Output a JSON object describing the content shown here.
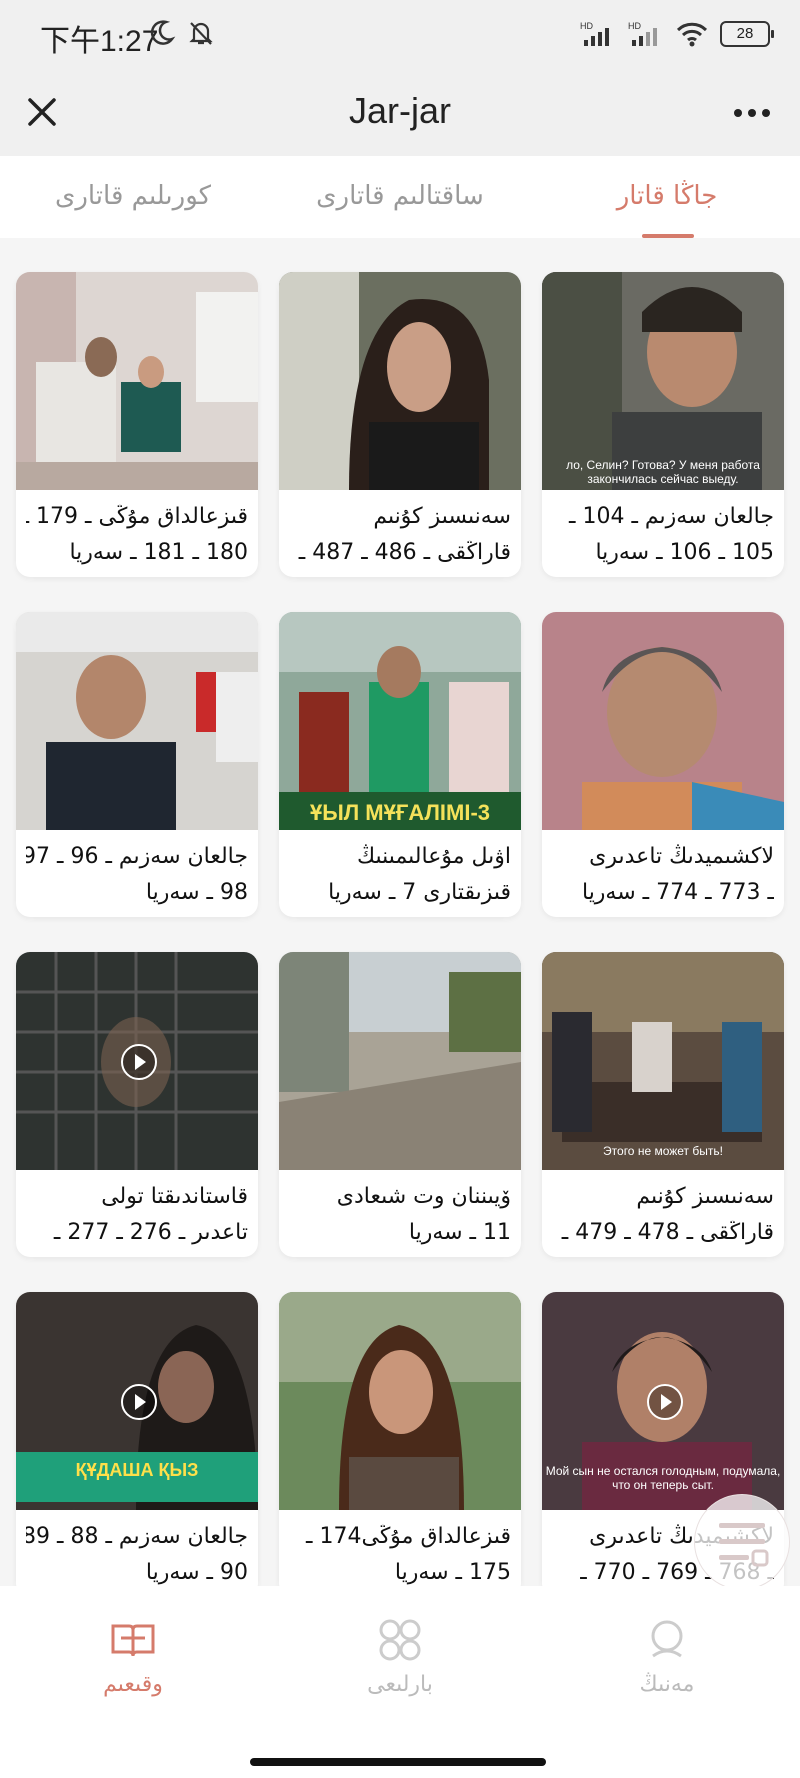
{
  "status": {
    "time": "下午1:27",
    "battery": "28"
  },
  "header": {
    "title": "Jar-jar"
  },
  "tabs": [
    {
      "label": "جاڭا قاتار",
      "active": true
    },
    {
      "label": "ساقتالىم قاتارى",
      "active": false
    },
    {
      "label": "كورىلىم قاتارى",
      "active": false
    }
  ],
  "cards": [
    {
      "line1": "جالعان سەزىم ـ 104 ـ",
      "line2": "105 ـ 106 ـ سەريا",
      "thumb_bg": "#5a5a55",
      "subtitle": "ло, Селин? Готова? У меня работа закончилась сейчас выеду."
    },
    {
      "line1": "سەنىسىز كۇنىم",
      "line2": "قاراڭقى ـ 486 ـ 487 ـ",
      "thumb_bg": "#4b4642",
      "subtitle": ""
    },
    {
      "line1": "قىزعالداق مۇڭى ـ 179 ـ",
      "line2": "180 ـ 181 ـ سەريا",
      "thumb_bg": "#c9c2bf",
      "subtitle": ""
    },
    {
      "line1": "لاكشىميدىڭ تاعدىرى",
      "line2": "ـ 773 ـ 774 ـ سەريا",
      "thumb_bg": "#b8838a",
      "subtitle": ""
    },
    {
      "line1": "اۋىل مۇعالىمىنىڭ",
      "line2": "قىزىقتارى 7 ـ سەريا",
      "thumb_bg": "#6b7f55",
      "subtitle": "ҰЫЛ МҰҒАЛІМІ-3"
    },
    {
      "line1": "جالعان سەزىم ـ 96 ـ 97 ـ",
      "line2": "98 ـ سەريا",
      "thumb_bg": "#3c3c3e",
      "subtitle": ""
    },
    {
      "line1": "سەنىسىز كۇنىم",
      "line2": "قاراڭقى ـ 478 ـ 479 ـ",
      "thumb_bg": "#4a4038",
      "subtitle": "Этого не может быть!"
    },
    {
      "line1": "ۆيىننان وت شىعادى",
      "line2": "11 ـ سەريا",
      "thumb_bg": "#8e8b80",
      "subtitle": ""
    },
    {
      "line1": "قاستاندىقتا تولى",
      "line2": "تاعدىر ـ 276 ـ 277 ـ",
      "thumb_bg": "#2e3330",
      "subtitle": ""
    },
    {
      "line1": "لاكشىميدىڭ تاعدىرى",
      "line2": "ـ 768 ـ 769 ـ 770 ـ",
      "thumb_bg": "#5b3f45",
      "subtitle": "Мой сын не остался голодным, подумала, что он теперь сыт."
    },
    {
      "line1": "قىزعالداق مۇڭى174 ـ",
      "line2": "175 ـ سەريا",
      "thumb_bg": "#6f5a4a",
      "subtitle": ""
    },
    {
      "line1": "جالعان سەزىم ـ 88 ـ 89 ـ",
      "line2": "90 ـ سەريا",
      "thumb_bg": "#3a3431",
      "subtitle": "ҚҰДАША ҚЫЗ"
    }
  ],
  "bottom_nav": [
    {
      "label": "مەنىڭ",
      "icon": "person-icon",
      "active": false
    },
    {
      "label": "بارلىعى",
      "icon": "grid-icon",
      "active": false
    },
    {
      "label": "وقىعىم",
      "icon": "book-icon",
      "active": true
    }
  ],
  "colors": {
    "accent": "#d57b6b",
    "inactive": "#999999",
    "grid_bg": "#f5f5f5"
  }
}
